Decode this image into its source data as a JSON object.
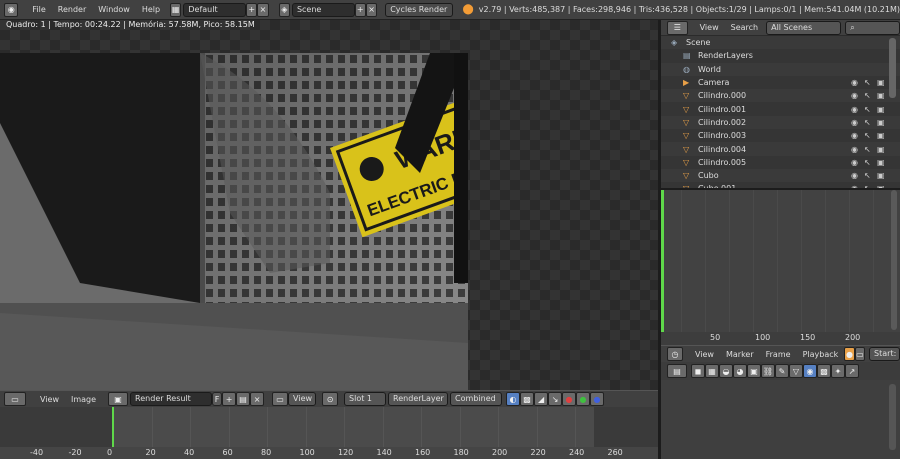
{
  "topbar": {
    "menus": [
      "File",
      "Render",
      "Window",
      "Help"
    ],
    "layout": "Default",
    "scene": "Scene",
    "engine": "Cycles Render",
    "stats": "v2.79 | Verts:485,387 | Faces:298,946 | Tris:436,528 | Objects:1/29 | Lamps:0/1 | Mem:541.04M (10.21M)"
  },
  "image_editor": {
    "status": "Quadro: 1 | Tempo: 00:24.22 | Memória: 57.58M, Pico: 58.15M",
    "sign_warning": "WARNING",
    "sign_sub": "ELECTRIC FENCE"
  },
  "image_header": {
    "view": "View",
    "image": "Image",
    "image_name": "Render Result",
    "f": "F",
    "view_menu": "View",
    "slot": "Slot 1",
    "layer": "RenderLayer",
    "pass": "Combined"
  },
  "outliner": {
    "view": "View",
    "search": "Search",
    "scenes": "All Scenes",
    "items": [
      {
        "label": "Scene",
        "icon": "scene-icon"
      },
      {
        "label": "RenderLayers",
        "icon": "render-layers-icon"
      },
      {
        "label": "World",
        "icon": "world-icon"
      },
      {
        "label": "Camera",
        "icon": "camera-icon"
      },
      {
        "label": "Cilindro.000",
        "icon": "mesh-icon"
      },
      {
        "label": "Cilindro.001",
        "icon": "mesh-icon"
      },
      {
        "label": "Cilindro.002",
        "icon": "mesh-icon"
      },
      {
        "label": "Cilindro.003",
        "icon": "mesh-icon"
      },
      {
        "label": "Cilindro.004",
        "icon": "mesh-icon"
      },
      {
        "label": "Cilindro.005",
        "icon": "mesh-icon"
      },
      {
        "label": "Cubo",
        "icon": "mesh-icon"
      },
      {
        "label": "Cubo.001",
        "icon": "mesh-icon"
      }
    ]
  },
  "timeline_right": {
    "ticks": [
      "50",
      "100",
      "150",
      "200"
    ],
    "menus": [
      "View",
      "Marker",
      "Frame",
      "Playback"
    ],
    "start": "Start:"
  },
  "bottom_timeline": {
    "ticks": [
      "-40",
      "-20",
      "0",
      "20",
      "40",
      "60",
      "80",
      "100",
      "120",
      "140",
      "160",
      "180",
      "200",
      "220",
      "240",
      "260"
    ]
  },
  "colors": {
    "accent_green": "#5fd84a",
    "sign_yellow": "#d9c21a",
    "mesh_orange": "#e8a048"
  }
}
